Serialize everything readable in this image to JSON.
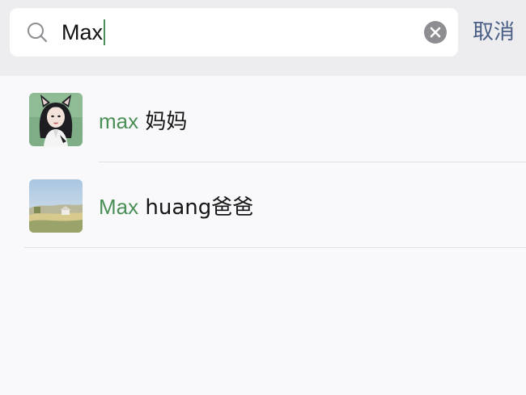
{
  "search": {
    "query": "Max",
    "cancel_label": "取消",
    "icons": {
      "search": "search-icon",
      "clear": "clear-icon"
    }
  },
  "results": [
    {
      "highlight": "max",
      "rest": " 妈妈",
      "avatar": "avatar-woman-with-cat-ears"
    },
    {
      "highlight": "Max",
      "rest": " huang爸爸",
      "avatar": "avatar-landscape"
    }
  ],
  "colors": {
    "highlight": "#4a8f56",
    "cancel": "#4b5f86",
    "background": "#f9f9fb",
    "search_bar": "#ededef"
  }
}
